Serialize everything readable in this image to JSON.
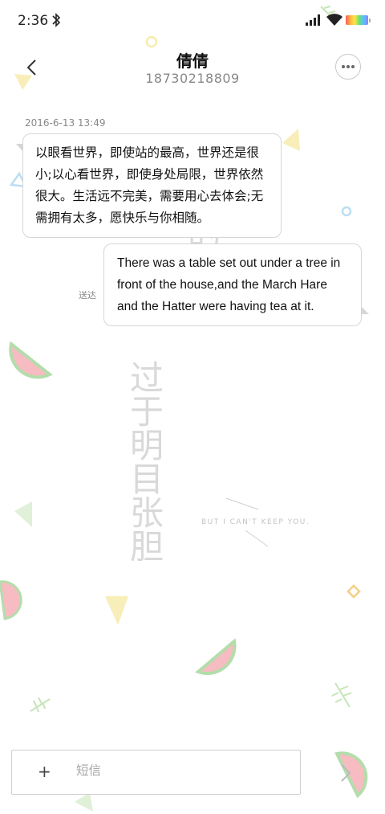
{
  "status": {
    "time": "2:36"
  },
  "header": {
    "contact_name": "倩倩",
    "contact_number": "18730218809"
  },
  "messages": [
    {
      "timestamp": "2016-6-13 13:49",
      "text": "以眼看世界，即使站的最高，世界还是很小;以心看世界，即使身处局限，世界依然很大。生活远不完美，需要用心去体会;无需拥有太多，愿快乐与你相随。"
    },
    {
      "text": "There was a table set out under a tree in front of the house,and the March Hare and the Hatter were having tea at it.",
      "status": "送达"
    }
  ],
  "input": {
    "placeholder": "短信",
    "plus_label": "+"
  },
  "wallpaper": {
    "vertical_text_1": "过于明目张胆",
    "vertical_text_2": "的偏爱",
    "caption": "BUT I CAN'T KEEP YOU."
  },
  "colors": {
    "bubble_border": "#d6d6d6",
    "watermelon": "#f29aa6",
    "rind": "#7fc27a",
    "yellow": "#f5e79a",
    "blue": "#8fc7e8"
  }
}
